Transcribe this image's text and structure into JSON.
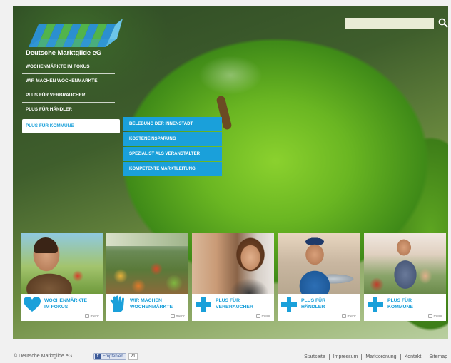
{
  "logo": {
    "text": "Deutsche Marktgilde eG"
  },
  "search": {
    "placeholder": ""
  },
  "nav": {
    "items": [
      {
        "label": "Wochenmärkte im Fokus"
      },
      {
        "label": "Wir machen Wochenmärkte"
      },
      {
        "label": "Plus für Verbraucher"
      },
      {
        "label": "Plus für Händler"
      },
      {
        "label": "Plus für Kommune"
      }
    ]
  },
  "submenu": {
    "items": [
      {
        "label": "Belebung der Innenstadt"
      },
      {
        "label": "Kosteneinsparung"
      },
      {
        "label": "Spezialist als Veranstalter"
      },
      {
        "label": "Kompetente Marktleitung"
      }
    ]
  },
  "tiles": [
    {
      "label": "Wochenmärkte\nim Fokus",
      "more": "mehr",
      "icon": "heart-icon"
    },
    {
      "label": "Wir machen\nWochenmärkte",
      "more": "mehr",
      "icon": "hand-icon"
    },
    {
      "label": "Plus für\nVerbraucher",
      "more": "mehr",
      "icon": "plus-icon"
    },
    {
      "label": "Plus für\nHändler",
      "more": "mehr",
      "icon": "plus-icon"
    },
    {
      "label": "Plus für\nKommune",
      "more": "mehr",
      "icon": "plus-icon"
    }
  ],
  "footer": {
    "copyright": "© Deutsche Marktgilde eG",
    "fb_label": "Empfehlen",
    "fb_count": "21",
    "links": [
      "Startseite",
      "Impressum",
      "Marktordnung",
      "Kontakt",
      "Sitemap"
    ]
  },
  "colors": {
    "accent": "#1aa0da",
    "apple": "#6ab622"
  }
}
